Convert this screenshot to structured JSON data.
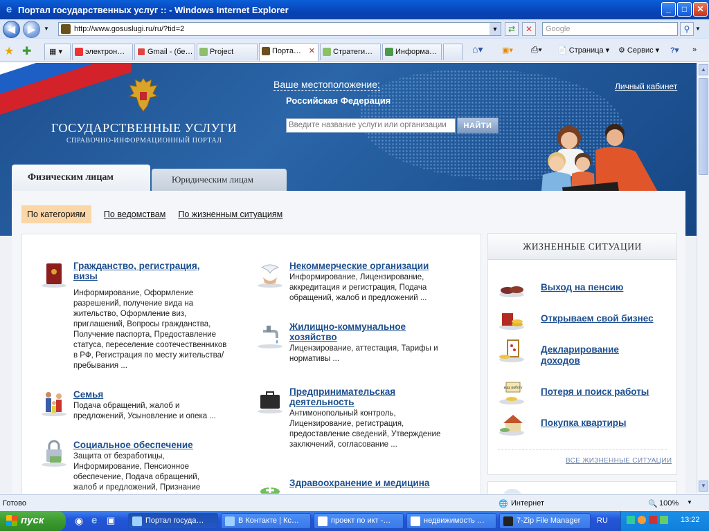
{
  "window": {
    "title": "Портал государственных услуг :: - Windows Internet Explorer",
    "controls": {
      "minimize": "_",
      "maximize": "□",
      "close": "✕"
    }
  },
  "navbar": {
    "back": "◀",
    "forward": "▶",
    "url": "http://www.gosuslugi.ru/ru/?tid=2",
    "search_placeholder": "Google"
  },
  "tabs": [
    {
      "label": "электрон…"
    },
    {
      "label": "Gmail - (бе…"
    },
    {
      "label": "Project"
    },
    {
      "label": "Порта…"
    },
    {
      "label": "Стратеги…"
    },
    {
      "label": "Информа…"
    }
  ],
  "tools": {
    "page": "Страница",
    "service": "Сервис"
  },
  "header": {
    "title": "ГОСУДАРСТВЕННЫЕ УСЛУГИ",
    "subtitle": "СПРАВОЧНО-ИНФОРМАЦИОННЫЙ ПОРТАЛ",
    "location_label": "Ваше местоположение:",
    "location_value": "Российская Федерация",
    "cabinet": "Личный кабинет",
    "search_placeholder": "Введите название услуги или организации",
    "search_button": "НАЙТИ"
  },
  "audience_tabs": {
    "individuals": "Физическим лицам",
    "legal": "Юридическим лицам"
  },
  "subnav": {
    "by_category": "По категориям",
    "by_agency": "По ведомствам",
    "by_life": "По жизненным ситуациям"
  },
  "categories": [
    {
      "title": "Гражданство, регистрация, визы",
      "desc": "Информирование, Оформление разрешений, получение вида на жительство, Оформление виз, приглашений, Вопросы гражданства, Получение паспорта, Предоставление статуса, переселение соотечественников в РФ, Регистрация по месту жительства/пребывания ..."
    },
    {
      "title": "Семья",
      "desc": "Подача обращений, жалоб и предложений, Усыновление и опека ..."
    },
    {
      "title": "Социальное обеспечение",
      "desc": "Защита от безработицы, Информирование, Пенсионное обеспечение, Подача обращений, жалоб и предложений, Признание"
    },
    {
      "title": "Некоммерческие организации",
      "desc": "Информирование, Лицензирование, аккредитация и регистрация, Подача обращений, жалоб и предложений ..."
    },
    {
      "title": "Жилищно-коммунальное хозяйство",
      "desc": "Лицензирование, аттестация, Тарифы и нормативы ..."
    },
    {
      "title": "Предпринимательская деятельность",
      "desc": "Антимонопольный контроль, Лицензирование, регистрация, предоставление сведений, Утверждение заключений, согласование ..."
    },
    {
      "title": "Здравоохранение и медицина",
      "desc": ""
    }
  ],
  "life": {
    "heading": "ЖИЗНЕННЫЕ СИТУАЦИИ",
    "items": [
      {
        "label": "Выход на пенсию"
      },
      {
        "label": "Открываем свой бизнес"
      },
      {
        "label": "Декларирование доходов"
      },
      {
        "label": "Потеря и поиск работы"
      },
      {
        "label": "Покупка квартиры"
      }
    ],
    "all_link": "ВСЕ ЖИЗНЕННЫЕ СИТУАЦИИ",
    "icon_sign": "ищу работу"
  },
  "status": {
    "ready": "Готово",
    "zone": "Интернет",
    "zoom": "100%"
  },
  "taskbar": {
    "start": "пуск",
    "items": [
      {
        "label": "Портал госуда…"
      },
      {
        "label": "В Контакте | Кс…"
      },
      {
        "label": "проект по икт -…"
      },
      {
        "label": "недвижимость …"
      },
      {
        "label": "7-Zip File Manager"
      }
    ],
    "lang": "RU",
    "clock": "13:22"
  }
}
